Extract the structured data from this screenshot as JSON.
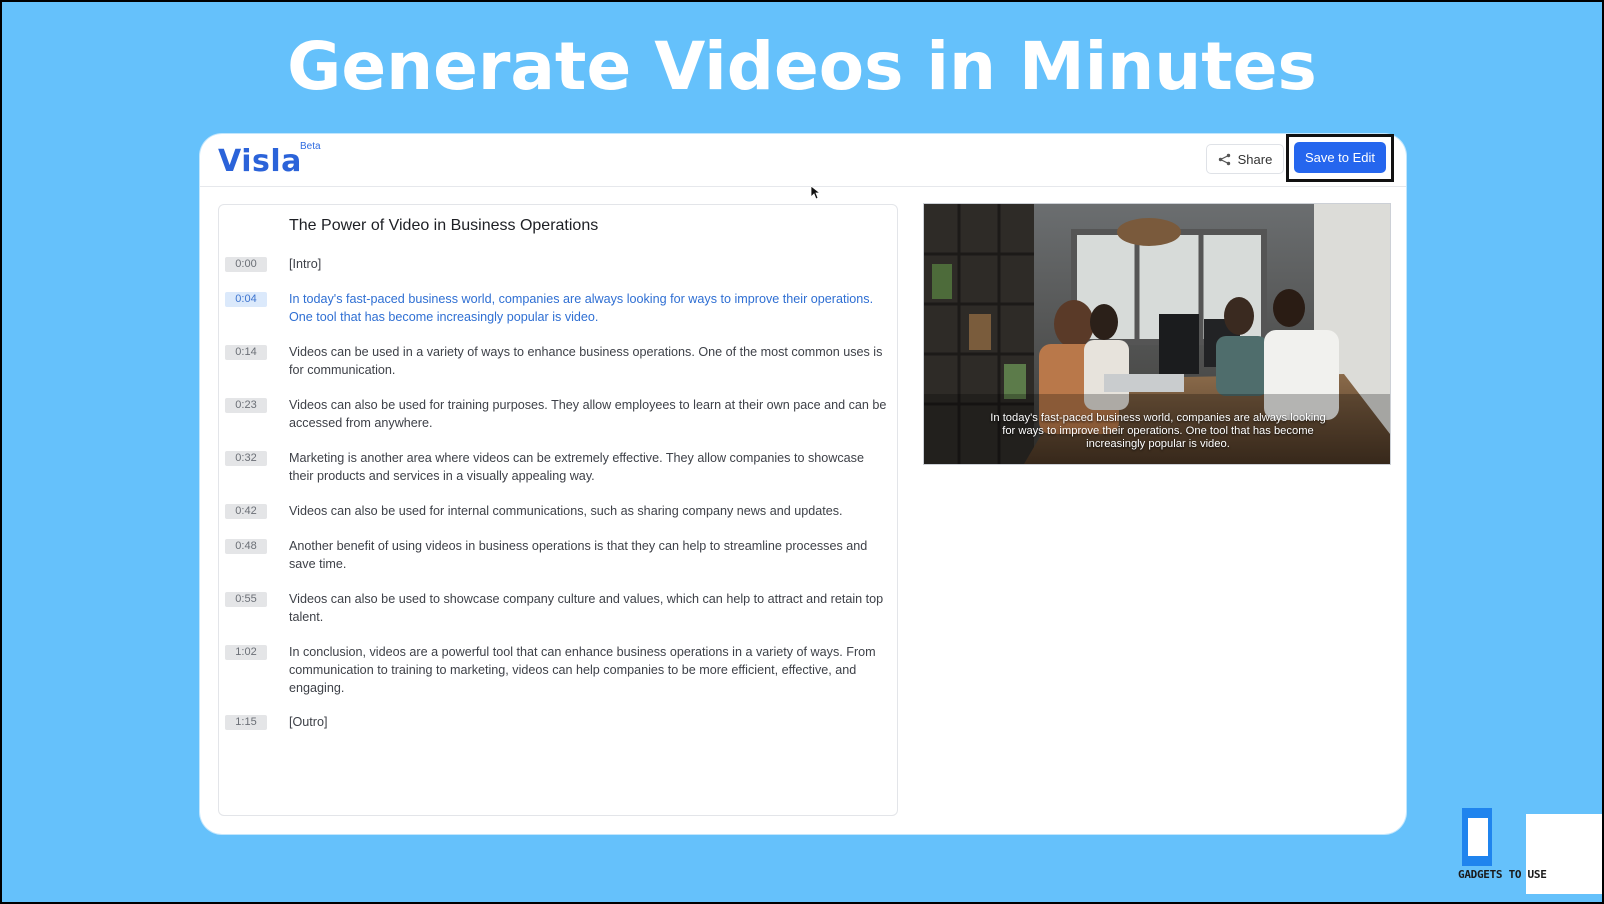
{
  "banner": {
    "headline": "Generate Videos in Minutes"
  },
  "app": {
    "logo": "Visla",
    "badge": "Beta",
    "share_label": "Share",
    "save_label": "Save to Edit",
    "accent_color": "#2566ee"
  },
  "script": {
    "title": "The Power of Video in Business Operations",
    "lines": [
      {
        "time": "0:00",
        "text": "[Intro]"
      },
      {
        "time": "0:04",
        "text": "In today's fast-paced business world, companies are always looking for ways to improve their operations. One tool that has become increasingly popular is video.",
        "active": true
      },
      {
        "time": "0:14",
        "text": "Videos can be used in a variety of ways to enhance business operations. One of the most common uses is for communication."
      },
      {
        "time": "0:23",
        "text": "Videos can also be used for training purposes. They allow employees to learn at their own pace and can be accessed from anywhere."
      },
      {
        "time": "0:32",
        "text": "Marketing is another area where videos can be extremely effective. They allow companies to showcase their products and services in a visually appealing way."
      },
      {
        "time": "0:42",
        "text": "Videos can also be used for internal communications, such as sharing company news and updates."
      },
      {
        "time": "0:48",
        "text": "Another benefit of using videos in business operations is that they can help to streamline processes and save time."
      },
      {
        "time": "0:55",
        "text": "Videos can also be used to showcase company culture and values, which can help to attract and retain top talent."
      },
      {
        "time": "1:02",
        "text": "In conclusion, videos are a powerful tool that can enhance business operations in a variety of ways. From communication to training to marketing, videos can help companies to be more efficient, effective, and engaging."
      },
      {
        "time": "1:15",
        "text": "[Outro]"
      }
    ]
  },
  "preview": {
    "caption": "In today's fast-paced business world, companies are always looking for ways to improve their operations. One tool that has become increasingly popular is video."
  },
  "watermark": {
    "text": "GADGETS TO USE"
  }
}
